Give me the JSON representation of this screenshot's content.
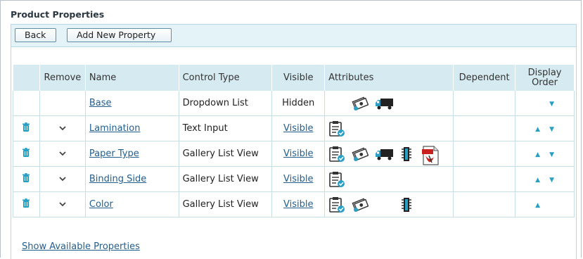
{
  "page": {
    "title": "Product Properties"
  },
  "toolbar": {
    "back_label": "Back",
    "add_label": "Add New Property"
  },
  "table": {
    "headers": {
      "delete": "",
      "remove": "Remove",
      "name": "Name",
      "control_type": "Control Type",
      "visible": "Visible",
      "attributes": "Attributes",
      "dependent": "Dependent",
      "display_order": "Display Order"
    },
    "rows": [
      {
        "name": "Base",
        "control_type": "Dropdown List",
        "visible": "Hidden",
        "visible_link": false,
        "attributes": [
          "",
          "money-icon",
          "truck-icon",
          "",
          ""
        ],
        "has_delete": false,
        "has_remove": false,
        "order_up": false,
        "order_down": true
      },
      {
        "name": "Lamination",
        "control_type": "Text Input",
        "visible": "Visible",
        "visible_link": true,
        "attributes": [
          "checklist-icon"
        ],
        "has_delete": true,
        "has_remove": true,
        "order_up": true,
        "order_down": true
      },
      {
        "name": "Paper Type",
        "control_type": "Gallery List View",
        "visible": "Visible",
        "visible_link": true,
        "attributes": [
          "checklist-icon",
          "money-icon",
          "truck-icon",
          "chip-icon",
          "pdf-icon"
        ],
        "has_delete": true,
        "has_remove": true,
        "order_up": true,
        "order_down": true
      },
      {
        "name": "Binding Side",
        "control_type": "Gallery List View",
        "visible": "Visible",
        "visible_link": true,
        "attributes": [
          "checklist-icon"
        ],
        "has_delete": true,
        "has_remove": true,
        "order_up": true,
        "order_down": true
      },
      {
        "name": "Color",
        "control_type": "Gallery List View",
        "visible": "Visible",
        "visible_link": true,
        "attributes": [
          "checklist-icon",
          "money-icon",
          "",
          "chip-icon"
        ],
        "has_delete": true,
        "has_remove": true,
        "order_up": true,
        "order_down": false
      }
    ]
  },
  "footer": {
    "show_available": "Show Available Properties"
  },
  "colors": {
    "accent": "#2a9fc4",
    "header_bg": "#d6ebf1",
    "link": "#245e8d"
  }
}
